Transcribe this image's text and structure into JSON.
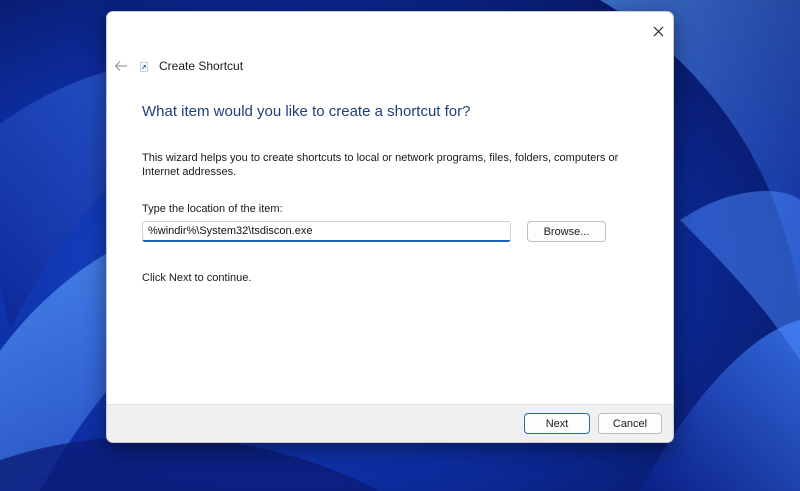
{
  "wizard": {
    "title": "Create Shortcut",
    "heading": "What item would you like to create a shortcut for?",
    "description": "This wizard helps you to create shortcuts to local or network programs, files, folders, computers or Internet addresses.",
    "location_label": "Type the location of the item:",
    "location_value": "%windir%\\System32\\tsdiscon.exe",
    "browse_label": "Browse...",
    "continue_text": "Click Next to continue.",
    "next_label": "Next",
    "cancel_label": "Cancel"
  },
  "icons": {
    "close": "close-icon",
    "back": "back-arrow-icon",
    "app": "shortcut-icon"
  },
  "colors": {
    "heading": "#1f3f79",
    "accent": "#1d62b5",
    "desktop_bg": "#0a1f7a"
  }
}
